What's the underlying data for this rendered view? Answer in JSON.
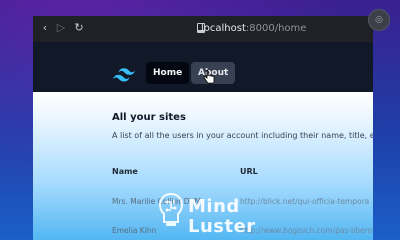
{
  "browser": {
    "address_host": "localhost",
    "address_rest": ":8000/home",
    "back_icon": "back-arrow-icon",
    "forward_icon": "forward-arrow-icon",
    "reload_icon": "reload-icon"
  },
  "app_nav": {
    "logo": "tailwind-logo-icon",
    "links": [
      {
        "label": "Home"
      },
      {
        "label": "About"
      }
    ]
  },
  "page": {
    "title": "All your sites",
    "description": "A list of all the users in your account including their name, title, email a"
  },
  "table": {
    "headers": [
      "Name",
      "URL"
    ],
    "rows": [
      {
        "name": "Mrs. Marilie Collier DVM",
        "url": "http://blick.net/qui-officia-tempora"
      },
      {
        "name": "Emelia Kihn",
        "url": "http://www.bogisich.com/pas-libero-ma"
      }
    ]
  },
  "watermark": {
    "line1": "Mind",
    "line2": "Luster"
  },
  "colors": {
    "nav_bg": "#111827",
    "active_link_bg": "#030712",
    "hover_link_bg": "#374151",
    "accent_logo": "#38bdf8"
  }
}
